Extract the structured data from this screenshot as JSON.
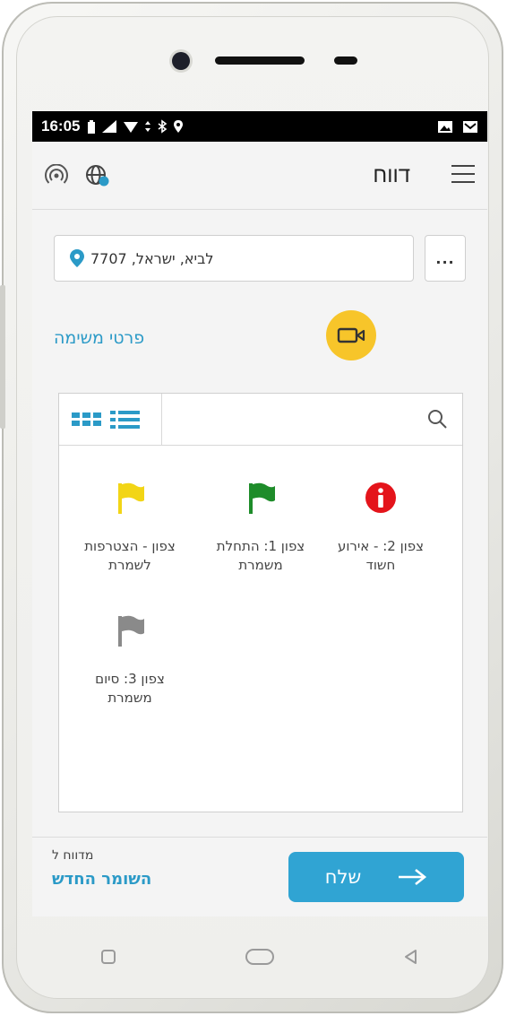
{
  "statusbar": {
    "time": "16:05"
  },
  "appbar": {
    "title": "דווח"
  },
  "location": {
    "text": "לביא, ישראל, 7707",
    "more_label": "..."
  },
  "task_details_link": "פרטי משימה",
  "items": [
    {
      "label_line1": "צפון 2: - אירוע",
      "label_line2": "חשוד",
      "icon": "info-icon",
      "color": "#e4141b"
    },
    {
      "label_line1": "צפון 1: התחלת",
      "label_line2": "משמרת",
      "icon": "flag-icon",
      "color": "#1e8c2a"
    },
    {
      "label_line1": "צפון - הצטרפות",
      "label_line2": "לשמרת",
      "icon": "flag-icon",
      "color": "#f2d516"
    },
    {
      "label_line1": "צפון 3: סיום",
      "label_line2": "משמרת",
      "icon": "flag-icon",
      "color": "#8a8a8a"
    }
  ],
  "footer": {
    "reported_to_label": "מדווח ל",
    "recipient": "השומר החדש",
    "send_label": "שלח"
  },
  "colors": {
    "accent": "#2b9ac7",
    "camera_button": "#f7c52a"
  }
}
